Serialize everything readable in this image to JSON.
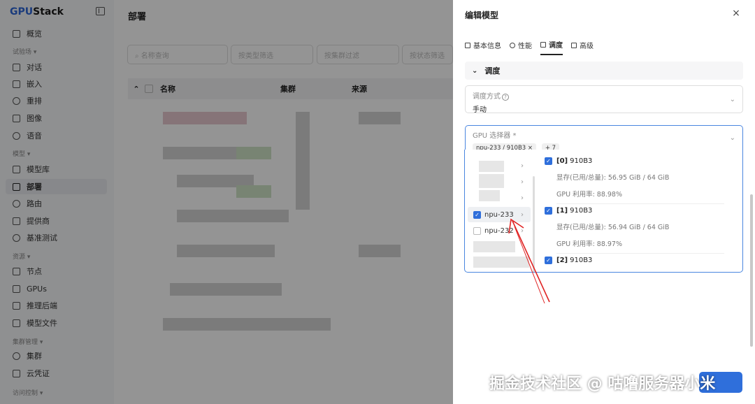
{
  "app": {
    "brand_a": "GPU",
    "brand_b": "Stack"
  },
  "sidebar": {
    "items_top": [
      {
        "label": "概览",
        "icon": "grid-icon"
      }
    ],
    "group1": "试验场 ▾",
    "items_g1": [
      {
        "label": "对话",
        "icon": "chat-icon"
      },
      {
        "label": "嵌入",
        "icon": "embed-icon"
      },
      {
        "label": "重排",
        "icon": "rerank-icon"
      },
      {
        "label": "图像",
        "icon": "image-icon"
      },
      {
        "label": "语音",
        "icon": "voice-icon"
      }
    ],
    "group2": "模型 ▾",
    "items_g2": [
      {
        "label": "模型库",
        "icon": "layers-icon"
      },
      {
        "label": "部署",
        "icon": "rocket-icon"
      },
      {
        "label": "路由",
        "icon": "route-icon"
      },
      {
        "label": "提供商",
        "icon": "provider-icon"
      },
      {
        "label": "基准测试",
        "icon": "gauge-icon"
      }
    ],
    "group3": "资源 ▾",
    "items_g3": [
      {
        "label": "节点",
        "icon": "node-icon"
      },
      {
        "label": "GPUs",
        "icon": "chip-icon"
      },
      {
        "label": "推理后端",
        "icon": "bolt-icon"
      },
      {
        "label": "模型文件",
        "icon": "file-icon"
      }
    ],
    "group4": "集群管理 ▾",
    "items_g4": [
      {
        "label": "集群",
        "icon": "cluster-icon"
      },
      {
        "label": "云凭证",
        "icon": "credential-icon"
      }
    ],
    "group5": "访问控制 ▾"
  },
  "main": {
    "title": "部署",
    "filters": [
      "名称查询",
      "按类型筛选",
      "按集群过滤",
      "按状态筛选"
    ],
    "columns": [
      "名称",
      "集群",
      "来源"
    ]
  },
  "drawer": {
    "title": "编辑模型",
    "tabs": [
      "基本信息",
      "性能",
      "调度",
      "高级"
    ],
    "active_tab": "调度",
    "section": "调度",
    "schedule_mode_label": "调度方式",
    "schedule_mode_value": "手动",
    "gpu_selector_label": "GPU 选择器",
    "gpu_selector_required": "*",
    "selected_tag": "npu-233 / 910B3",
    "more_tag": "+ 7",
    "cascader_left": [
      {
        "label": "",
        "checked": false
      },
      {
        "label": "",
        "checked": false
      },
      {
        "label": "",
        "checked": false
      },
      {
        "label": "npu-233",
        "checked": true
      },
      {
        "label": "npu-232",
        "checked": false
      },
      {
        "label": "",
        "checked": false
      }
    ],
    "gpus": [
      {
        "index": "[0]",
        "name": "910B3",
        "memory": "显存(已用/总量): 56.95 GiB / 64 GiB",
        "util": "GPU 利用率: 88.98%"
      },
      {
        "index": "[1]",
        "name": "910B3",
        "memory": "显存(已用/总量): 56.94 GiB / 64 GiB",
        "util": "GPU 利用率: 88.97%"
      },
      {
        "index": "[2]",
        "name": "910B3"
      }
    ],
    "close_glyph": "×"
  },
  "watermark": "掘金技术社区 @ 咕噜服务器小米",
  "colors": {
    "accent": "#2f6fdb",
    "arrow": "#e02424"
  }
}
